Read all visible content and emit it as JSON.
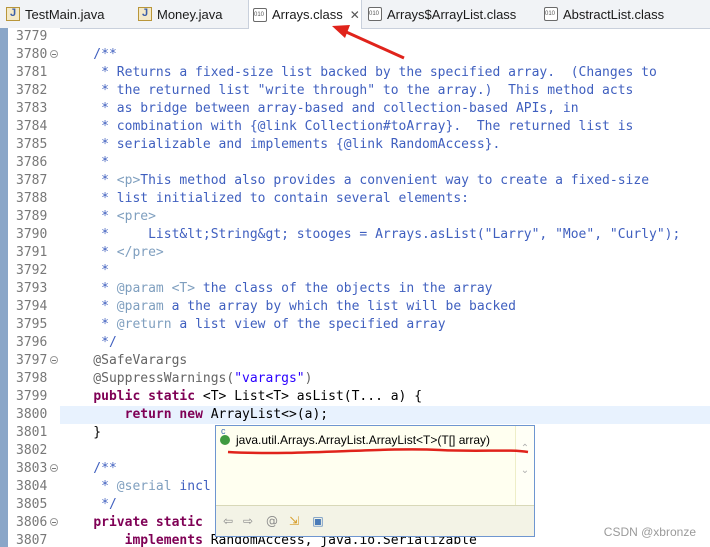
{
  "tabs": [
    {
      "label": "TestMain.java",
      "icon": "java-file-icon",
      "active": false
    },
    {
      "label": "Money.java",
      "icon": "java-file-icon",
      "active": false
    },
    {
      "label": "Arrays.class",
      "icon": "class-file-icon",
      "active": true,
      "close": "✕"
    },
    {
      "label": "Arrays$ArrayList.class",
      "icon": "class-file-icon",
      "active": false
    },
    {
      "label": "AbstractList.class",
      "icon": "class-file-icon",
      "active": false
    }
  ],
  "lines": [
    {
      "num": "3779",
      "fold": false,
      "segs": []
    },
    {
      "num": "3780",
      "fold": true,
      "segs": [
        {
          "t": "    /**",
          "c": "doc"
        }
      ]
    },
    {
      "num": "3781",
      "fold": false,
      "segs": [
        {
          "t": "     * Returns a fixed-size list backed by the specified array.  (Changes to",
          "c": "doc"
        }
      ]
    },
    {
      "num": "3782",
      "fold": false,
      "segs": [
        {
          "t": "     * the returned list \"write through\" to the array.)  This method acts",
          "c": "doc"
        }
      ]
    },
    {
      "num": "3783",
      "fold": false,
      "segs": [
        {
          "t": "     * as bridge between array-based and collection-based APIs, in",
          "c": "doc"
        }
      ]
    },
    {
      "num": "3784",
      "fold": false,
      "segs": [
        {
          "t": "     * combination with {@link Collection#toArray}.  The returned list is",
          "c": "doc"
        }
      ]
    },
    {
      "num": "3785",
      "fold": false,
      "segs": [
        {
          "t": "     * serializable and implements {@link RandomAccess}.",
          "c": "doc"
        }
      ]
    },
    {
      "num": "3786",
      "fold": false,
      "segs": [
        {
          "t": "     *",
          "c": "doc"
        }
      ]
    },
    {
      "num": "3787",
      "fold": false,
      "segs": [
        {
          "t": "     * ",
          "c": "doc"
        },
        {
          "t": "<p>",
          "c": "tag"
        },
        {
          "t": "This method also provides a convenient way to create a fixed-size",
          "c": "doc"
        }
      ]
    },
    {
      "num": "3788",
      "fold": false,
      "segs": [
        {
          "t": "     * list initialized to contain several elements:",
          "c": "doc"
        }
      ]
    },
    {
      "num": "3789",
      "fold": false,
      "segs": [
        {
          "t": "     * ",
          "c": "doc"
        },
        {
          "t": "<pre>",
          "c": "tag"
        }
      ]
    },
    {
      "num": "3790",
      "fold": false,
      "segs": [
        {
          "t": "     *     List&lt;String&gt; stooges = Arrays.asList(\"Larry\", \"Moe\", \"Curly\");",
          "c": "doc"
        }
      ]
    },
    {
      "num": "3791",
      "fold": false,
      "segs": [
        {
          "t": "     * ",
          "c": "doc"
        },
        {
          "t": "</pre>",
          "c": "tag"
        }
      ]
    },
    {
      "num": "3792",
      "fold": false,
      "segs": [
        {
          "t": "     *",
          "c": "doc"
        }
      ]
    },
    {
      "num": "3793",
      "fold": false,
      "segs": [
        {
          "t": "     * ",
          "c": "doc"
        },
        {
          "t": "@param",
          "c": "tag"
        },
        {
          "t": " ",
          "c": "doc"
        },
        {
          "t": "<T>",
          "c": "tag"
        },
        {
          "t": " the class of the objects in the array",
          "c": "doc"
        }
      ]
    },
    {
      "num": "3794",
      "fold": false,
      "segs": [
        {
          "t": "     * ",
          "c": "doc"
        },
        {
          "t": "@param",
          "c": "tag"
        },
        {
          "t": " a the array by which the list will be backed",
          "c": "doc"
        }
      ]
    },
    {
      "num": "3795",
      "fold": false,
      "segs": [
        {
          "t": "     * ",
          "c": "doc"
        },
        {
          "t": "@return",
          "c": "tag"
        },
        {
          "t": " a list view of the specified array",
          "c": "doc"
        }
      ]
    },
    {
      "num": "3796",
      "fold": false,
      "segs": [
        {
          "t": "     */",
          "c": "doc"
        }
      ]
    },
    {
      "num": "3797",
      "fold": true,
      "segs": [
        {
          "t": "    @SafeVarargs",
          "c": "ann"
        }
      ]
    },
    {
      "num": "3798",
      "fold": false,
      "segs": [
        {
          "t": "    @SuppressWarnings(",
          "c": "ann"
        },
        {
          "t": "\"varargs\"",
          "c": "str"
        },
        {
          "t": ")",
          "c": "ann"
        }
      ]
    },
    {
      "num": "3799",
      "fold": false,
      "segs": [
        {
          "t": "    ",
          "c": ""
        },
        {
          "t": "public static",
          "c": "kw"
        },
        {
          "t": " <T> List<T> asList(T... a) {",
          "c": ""
        }
      ]
    },
    {
      "num": "3800",
      "fold": false,
      "current": true,
      "segs": [
        {
          "t": "        ",
          "c": ""
        },
        {
          "t": "return new",
          "c": "kw"
        },
        {
          "t": " ArrayList<>(a);",
          "c": ""
        }
      ]
    },
    {
      "num": "3801",
      "fold": false,
      "segs": [
        {
          "t": "    }",
          "c": ""
        }
      ]
    },
    {
      "num": "3802",
      "fold": false,
      "segs": []
    },
    {
      "num": "3803",
      "fold": true,
      "segs": [
        {
          "t": "    /**",
          "c": "doc"
        }
      ]
    },
    {
      "num": "3804",
      "fold": false,
      "segs": [
        {
          "t": "     * ",
          "c": "doc"
        },
        {
          "t": "@serial",
          "c": "tag"
        },
        {
          "t": " incl",
          "c": "doc"
        }
      ]
    },
    {
      "num": "3805",
      "fold": false,
      "segs": [
        {
          "t": "     */",
          "c": "doc"
        }
      ]
    },
    {
      "num": "3806",
      "fold": true,
      "segs": [
        {
          "t": "    ",
          "c": ""
        },
        {
          "t": "private static",
          "c": "kw"
        }
      ]
    },
    {
      "num": "3807",
      "fold": false,
      "segs": [
        {
          "t": "        ",
          "c": ""
        },
        {
          "t": "implements",
          "c": "kw"
        },
        {
          "t": " RandomAccess, java.io.Serializable",
          "c": ""
        }
      ]
    }
  ],
  "popup": {
    "item": "java.util.Arrays.ArrayList.ArrayList<T>(T[] array)",
    "item_icon": "constructor-icon",
    "up": "⌃",
    "down": "⌄",
    "toolbar": [
      {
        "name": "back-icon",
        "glyph": "⇦"
      },
      {
        "name": "forward-icon",
        "glyph": "⇨"
      },
      {
        "name": "at-icon",
        "glyph": "@"
      },
      {
        "name": "open-declaration-icon",
        "glyph": "⇲"
      },
      {
        "name": "open-attached-javadoc-icon",
        "glyph": "▣"
      }
    ]
  },
  "watermark": "CSDN @xbronze",
  "colors": {
    "ruler": "#8aa6c8",
    "doc": "#3f5fbf",
    "keyword": "#7f0055",
    "string": "#2a00ff",
    "annotation_red": "#e0231b"
  }
}
